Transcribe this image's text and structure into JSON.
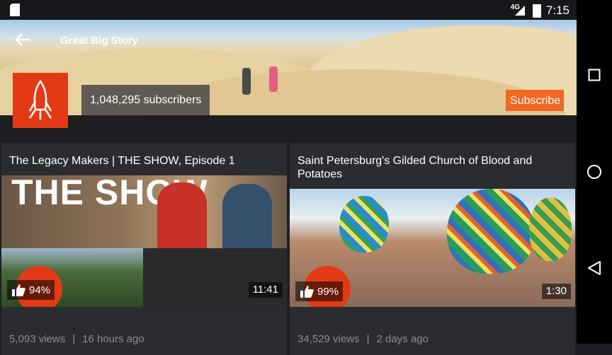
{
  "status_bar": {
    "network": "4G",
    "time": "7:15"
  },
  "channel": {
    "title": "Great Big Story",
    "subscribers": "1,048,295 subscribers",
    "subscribe_label": "Subscribe"
  },
  "videos": [
    {
      "title": "The Legacy Makers | THE SHOW, Episode 1",
      "thumb_text": "THE SHOW",
      "likes": "94%",
      "duration": "11:41",
      "views": "5,093 views",
      "age": "16 hours ago"
    },
    {
      "title": "Saint Petersburg's Gilded Church of Blood and Potatoes",
      "likes": "99%",
      "duration": "1:30",
      "views": "34,529 views",
      "age": "2 days ago"
    }
  ],
  "nav_icons": [
    "square-icon",
    "circle-icon",
    "triangle-back-icon"
  ]
}
